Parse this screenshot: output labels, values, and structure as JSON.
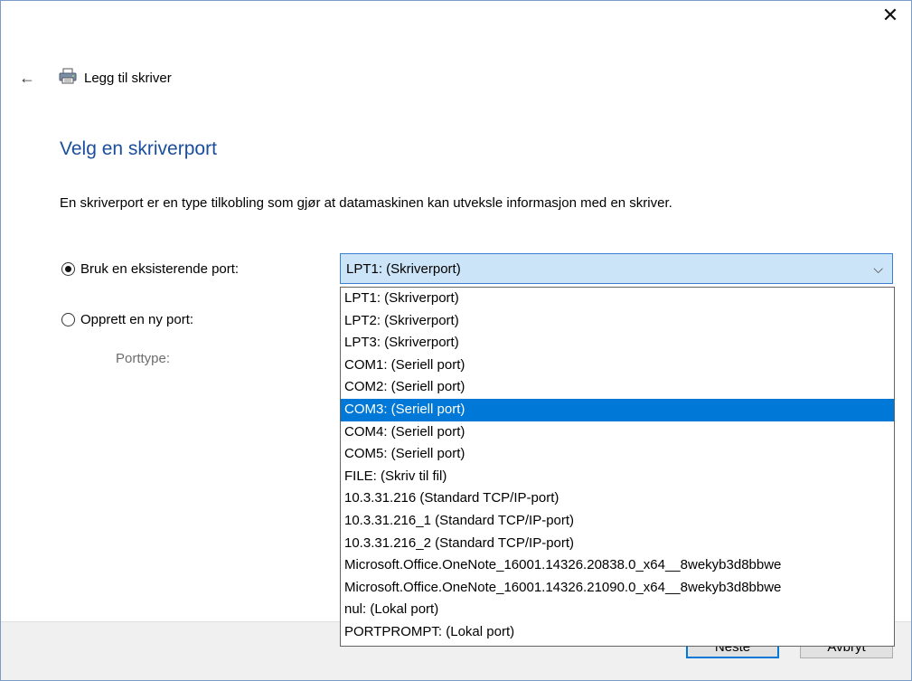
{
  "window": {
    "close_glyph": "✕"
  },
  "header": {
    "back_glyph": "←",
    "title": "Legg til skriver",
    "printer_icon": "printer-icon"
  },
  "page": {
    "heading": "Velg en skriverport",
    "description": "En skriverport er en type tilkobling som gjør at datamaskinen kan utveksle informasjon med en skriver."
  },
  "options": {
    "existing_label": "Bruk en eksisterende port:",
    "new_label": "Opprett en ny port:",
    "porttype_label": "Porttype:"
  },
  "select": {
    "value": "LPT1: (Skriverport)",
    "chevron": "⌵"
  },
  "dropdown": {
    "selected_index": 5,
    "items": [
      "LPT1: (Skriverport)",
      "LPT2: (Skriverport)",
      "LPT3: (Skriverport)",
      "COM1: (Seriell port)",
      "COM2: (Seriell port)",
      "COM3: (Seriell port)",
      "COM4: (Seriell port)",
      "COM5: (Seriell port)",
      "FILE: (Skriv til fil)",
      "10.3.31.216 (Standard TCP/IP-port)",
      "10.3.31.216_1 (Standard TCP/IP-port)",
      "10.3.31.216_2 (Standard TCP/IP-port)",
      "Microsoft.Office.OneNote_16001.14326.20838.0_x64__8wekyb3d8bbwe",
      "Microsoft.Office.OneNote_16001.14326.21090.0_x64__8wekyb3d8bbwe",
      "nul: (Lokal port)",
      "PORTPROMPT: (Lokal port)"
    ]
  },
  "footer": {
    "next_label": "Neste",
    "cancel_label": "Avbryt"
  },
  "colors": {
    "accent": "#0078d7",
    "heading": "#1a4e9c",
    "select_bg": "#cce4f7"
  }
}
